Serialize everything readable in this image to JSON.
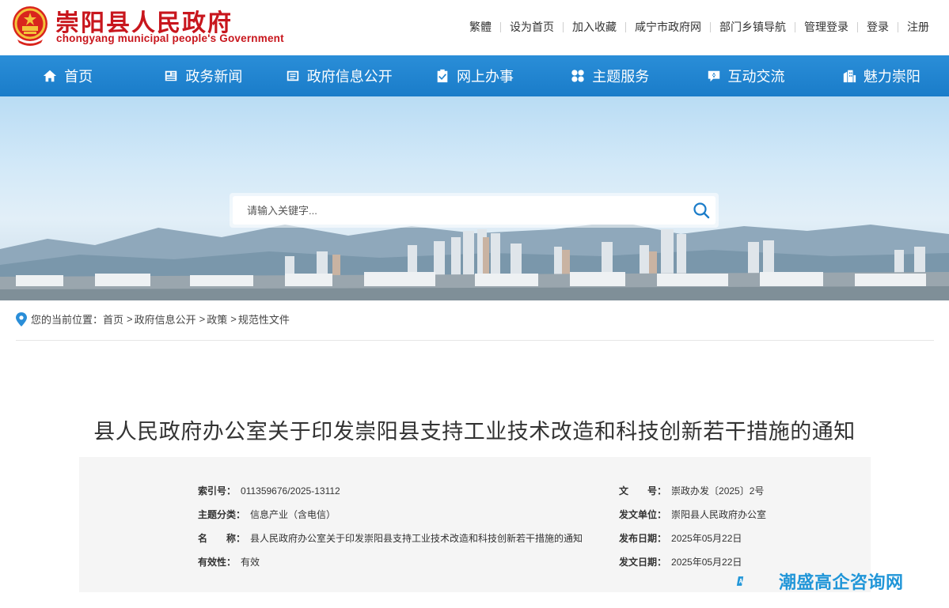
{
  "header": {
    "title": "崇阳县人民政府",
    "subtitle": "chongyang municipal people's Government",
    "links": [
      "繁體",
      "设为首页",
      "加入收藏",
      "咸宁市政府网",
      "部门乡镇导航",
      "管理登录",
      "登录",
      "注册"
    ]
  },
  "nav": [
    {
      "label": "首页",
      "icon": "home-icon"
    },
    {
      "label": "政务新闻",
      "icon": "news-icon"
    },
    {
      "label": "政府信息公开",
      "icon": "list-icon"
    },
    {
      "label": "网上办事",
      "icon": "clipboard-check-icon"
    },
    {
      "label": "主题服务",
      "icon": "grid-icon"
    },
    {
      "label": "互动交流",
      "icon": "chat-icon"
    },
    {
      "label": "魅力崇阳",
      "icon": "building-icon"
    }
  ],
  "search": {
    "placeholder": "请输入关键字..."
  },
  "breadcrumb": {
    "prefix": "您的当前位置：",
    "items": [
      "首页",
      "政府信息公开",
      "政策",
      "规范性文件"
    ]
  },
  "document": {
    "title": "县人民政府办公室关于印发崇阳县支持工业技术改造和科技创新若干措施的通知",
    "meta_left": [
      {
        "key": "索引号：",
        "value": "011359676/2025-13112"
      },
      {
        "key": "主题分类：",
        "value": "信息产业（含电信）"
      },
      {
        "key": "名　　称：",
        "value": "县人民政府办公室关于印发崇阳县支持工业技术改造和科技创新若干措施的通知"
      },
      {
        "key": "有效性：",
        "value": "有效"
      }
    ],
    "meta_right": [
      {
        "key": "文　　号：",
        "value": "崇政办发〔2025〕2号"
      },
      {
        "key": "发文单位：",
        "value": "崇阳县人民政府办公室"
      },
      {
        "key": "发布日期：",
        "value": "2025年05月22日"
      },
      {
        "key": "发文日期：",
        "value": "2025年05月22日"
      }
    ]
  },
  "watermark": {
    "text": "潮盛高企咨询网"
  },
  "colors": {
    "brand_red": "#c8161d",
    "nav_blue": "#1a7cc9",
    "watermark_blue": "#2196d8"
  }
}
